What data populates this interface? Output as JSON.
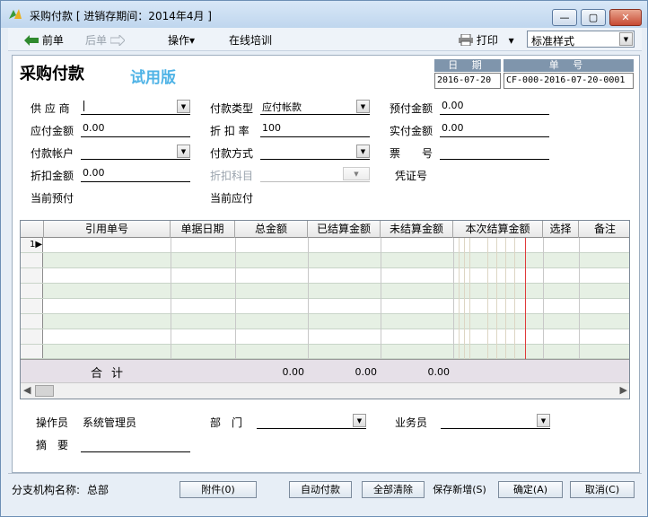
{
  "window": {
    "title": "采购付款 [ 进销存期间：2014年4月 ]",
    "minimize": "—",
    "maximize": "▢",
    "close": "✕"
  },
  "toolbar": {
    "prev": "前单",
    "next": "后单",
    "operate": "操作",
    "training": "在线培训",
    "print": "打印",
    "style_value": "标准样式"
  },
  "form": {
    "title": "采购付款",
    "trial": "试用版",
    "date_header": "日 期",
    "date_value": "2016-07-20",
    "no_header": "单 号",
    "no_value": "CF-000-2016-07-20-0001",
    "supplier_label": "供 应 商",
    "supplier_value": "",
    "pay_type_label": "付款类型",
    "pay_type_value": "应付帐款",
    "prepay_label": "预付金额",
    "prepay_value": "0.00",
    "payable_label": "应付金额",
    "payable_value": "0.00",
    "discount_rate_label": "折 扣 率",
    "discount_rate_value": "100",
    "actual_label": "实付金额",
    "actual_value": "0.00",
    "account_label": "付款帐户",
    "account_value": "",
    "pay_method_label": "付款方式",
    "pay_method_value": "",
    "invoice_label": "票　　号",
    "invoice_value": "",
    "discount_amt_label": "折扣金额",
    "discount_amt_value": "0.00",
    "discount_subject_label": "折扣科目",
    "voucher_label": "凭证号",
    "current_prepay_label": "当前预付",
    "current_payable_label": "当前应付"
  },
  "grid": {
    "columns": [
      "引用单号",
      "单据日期",
      "总金额",
      "已结算金额",
      "未结算金额",
      "本次结算金额",
      "选择",
      "备注"
    ],
    "first_row_marker": "1",
    "total_label": "合计",
    "totals": [
      "0.00",
      "0.00",
      "0.00"
    ]
  },
  "footer": {
    "operator_label": "操作员",
    "operator_value": "系统管理员",
    "dept_label": "部　门",
    "dept_value": "",
    "salesman_label": "业务员",
    "salesman_value": "",
    "memo_label": "摘　要",
    "memo_value": ""
  },
  "status": {
    "branch_label": "分支机构名称:",
    "branch_value": "总部",
    "attach": "附件(0)",
    "auto_pay": "自动付款",
    "clear_all": "全部清除",
    "save_new": "保存新增(S)",
    "confirm": "确定(A)",
    "cancel": "取消(C)"
  }
}
